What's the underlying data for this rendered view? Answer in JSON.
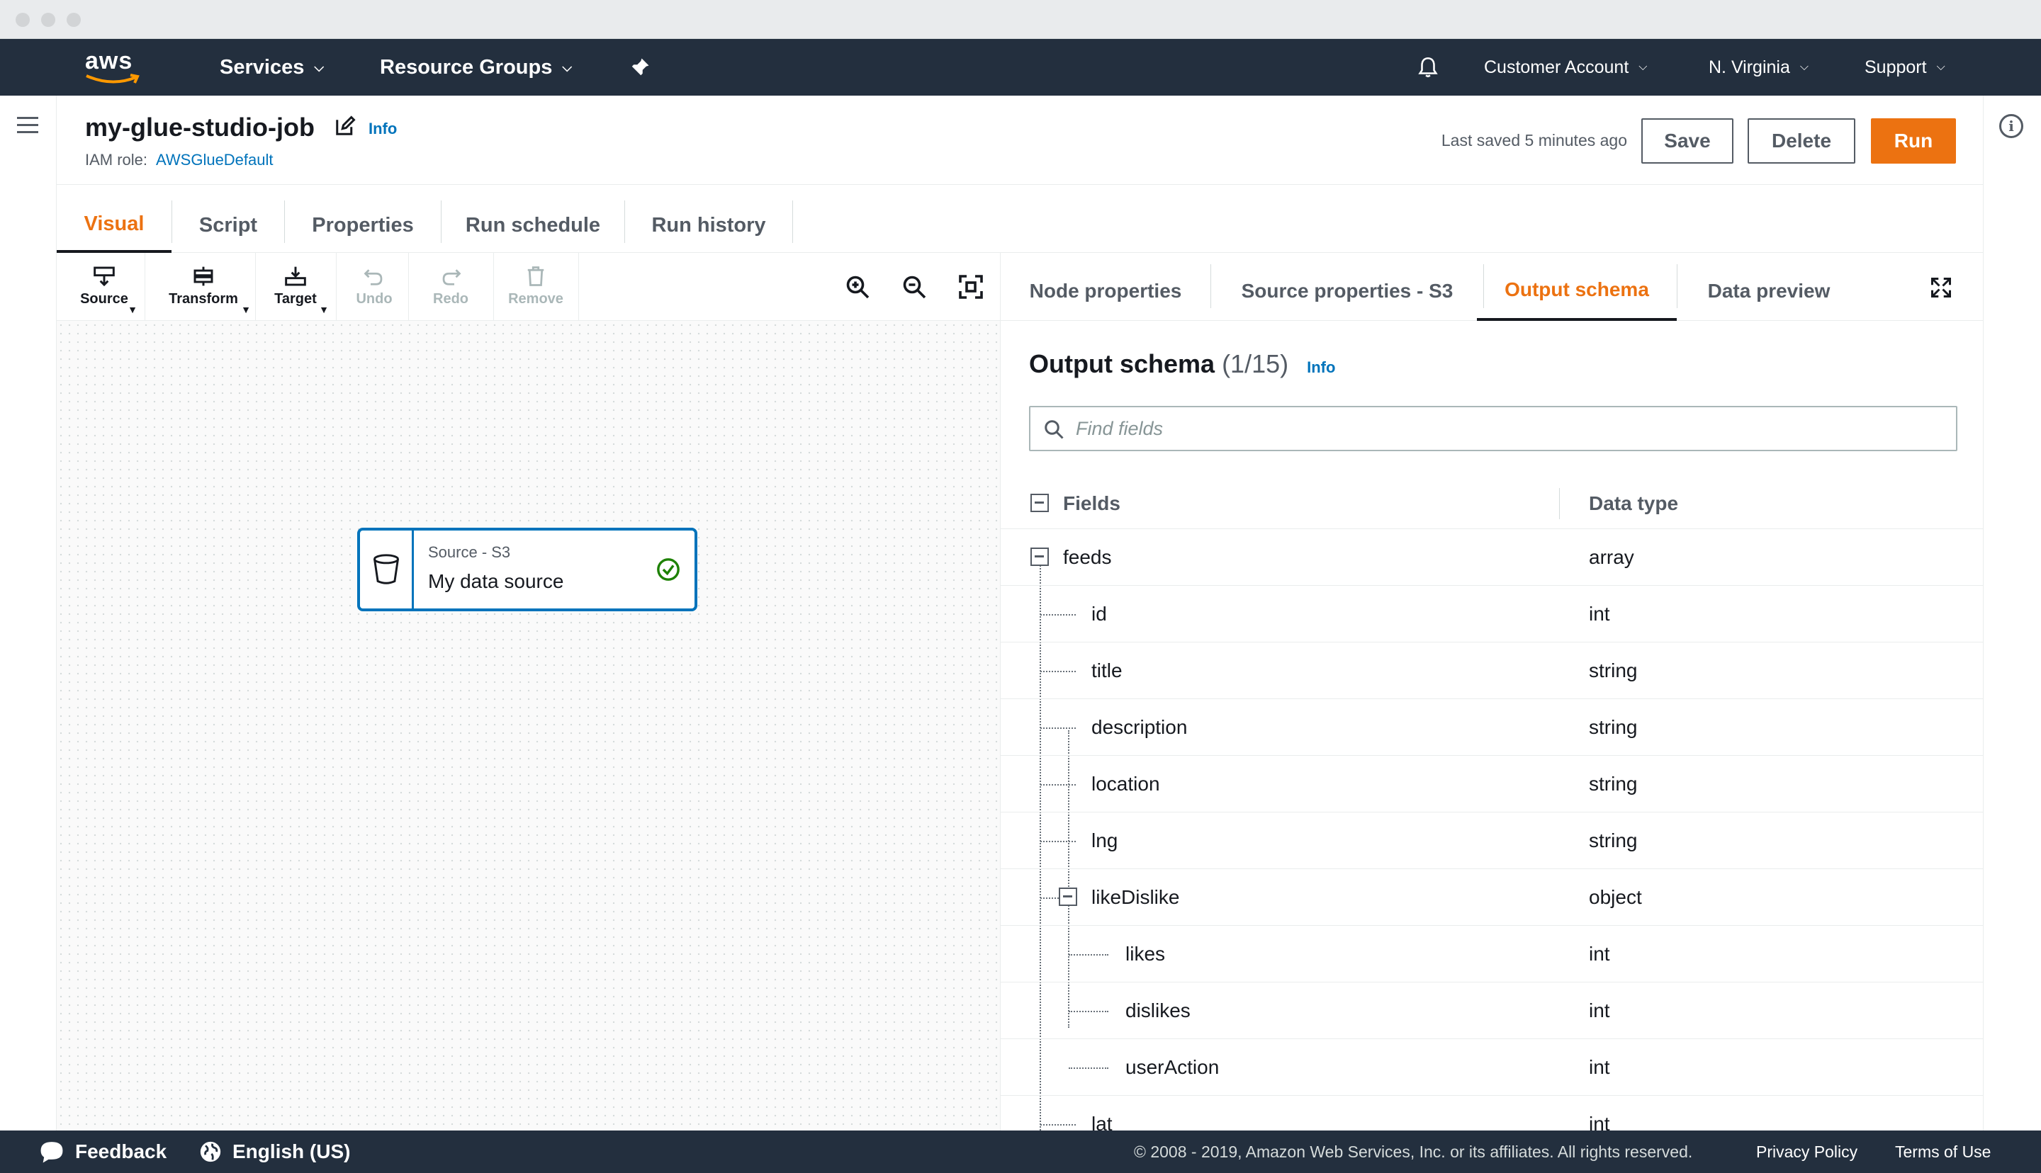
{
  "nav": {
    "logo": "aws",
    "services": "Services",
    "resource_groups": "Resource Groups",
    "account": "Customer Account",
    "region": "N. Virginia",
    "support": "Support"
  },
  "header": {
    "job_name": "my-glue-studio-job",
    "info": "Info",
    "iam_role_label": "IAM role:",
    "iam_role_value": "AWSGlueDefault",
    "last_saved": "Last saved 5 minutes ago",
    "save": "Save",
    "delete": "Delete",
    "run": "Run"
  },
  "main_tabs": [
    "Visual",
    "Script",
    "Properties",
    "Run schedule",
    "Run history"
  ],
  "toolbar": {
    "source": "Source",
    "transform": "Transform",
    "target": "Target",
    "undo": "Undo",
    "redo": "Redo",
    "remove": "Remove"
  },
  "node": {
    "type": "Source - S3",
    "name": "My data source"
  },
  "right_tabs": [
    "Node properties",
    "Source properties - S3",
    "Output schema",
    "Data preview"
  ],
  "schema": {
    "title": "Output schema",
    "count": "(1/15)",
    "info": "Info",
    "search_placeholder": "Find fields",
    "col_fields": "Fields",
    "col_type": "Data type",
    "rows": [
      {
        "name": "feeds",
        "type": "array"
      },
      {
        "name": "id",
        "type": "int"
      },
      {
        "name": "title",
        "type": "string"
      },
      {
        "name": "description",
        "type": "string"
      },
      {
        "name": "location",
        "type": "string"
      },
      {
        "name": "lng",
        "type": "string"
      },
      {
        "name": "likeDislike",
        "type": "object"
      },
      {
        "name": "likes",
        "type": "int"
      },
      {
        "name": "dislikes",
        "type": "int"
      },
      {
        "name": "userAction",
        "type": "int"
      },
      {
        "name": "lat",
        "type": "int"
      }
    ]
  },
  "footer": {
    "feedback": "Feedback",
    "language": "English (US)",
    "copyright": "© 2008 - 2019, Amazon Web Services, Inc. or its affiliates. All rights reserved.",
    "privacy": "Privacy Policy",
    "terms": "Terms of Use"
  }
}
